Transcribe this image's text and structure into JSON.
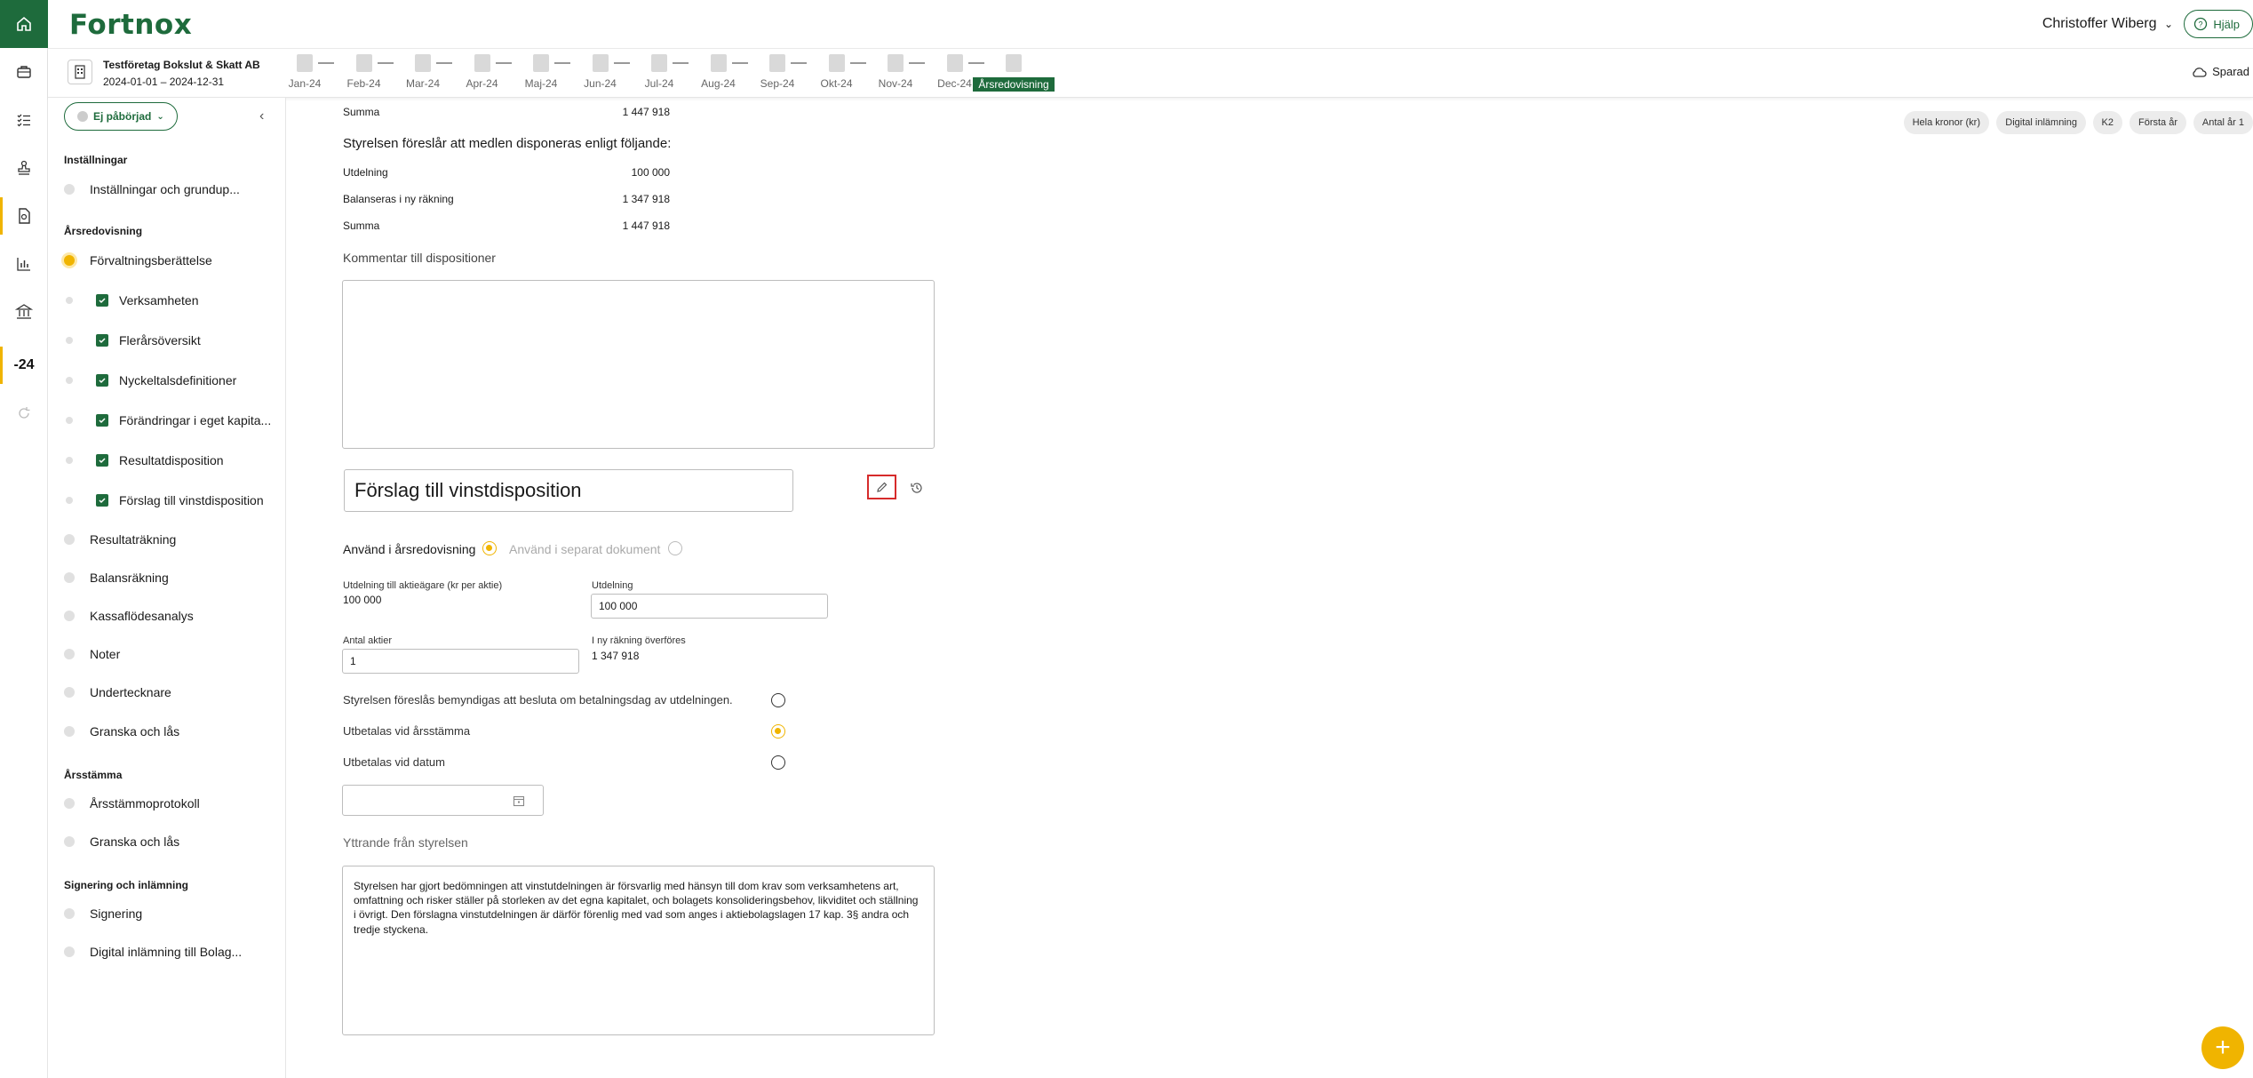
{
  "app": {
    "logo": "Fortnox",
    "user": "Christoffer Wiberg",
    "help": "Hjälp",
    "saved": "Sparad"
  },
  "rail": {
    "year_label": "-24"
  },
  "company": {
    "name": "Testföretag Bokslut & Skatt AB",
    "period": "2024-01-01 – 2024-12-31"
  },
  "timeline": [
    "Jan-24",
    "Feb-24",
    "Mar-24",
    "Apr-24",
    "Maj-24",
    "Jun-24",
    "Jul-24",
    "Aug-24",
    "Sep-24",
    "Okt-24",
    "Nov-24",
    "Dec-24",
    "Årsredovisning"
  ],
  "sidebar": {
    "status": "Ej påbörjad",
    "sections": {
      "settings": "Inställningar",
      "annual_report": "Årsredovisning",
      "agm": "Årsstämma",
      "signing": "Signering och inlämning"
    },
    "items": {
      "settings_basics": "Inställningar och grundup...",
      "management_report": "Förvaltningsberättelse",
      "operations": "Verksamheten",
      "multi_year": "Flerårsöversikt",
      "key_ratios": "Nyckeltalsdefinitioner",
      "equity_changes": "Förändringar i eget kapita...",
      "result_disposition": "Resultatdisposition",
      "profit_proposal": "Förslag till vinstdisposition",
      "income_statement": "Resultaträkning",
      "balance_sheet": "Balansräkning",
      "cash_flow": "Kassaflödesanalys",
      "notes": "Noter",
      "signatories": "Undertecknare",
      "review_lock_1": "Granska och lås",
      "agm_minutes": "Årsstämmoprotokoll",
      "review_lock_2": "Granska och lås",
      "signing": "Signering",
      "digital_submission": "Digital inlämning till Bolag..."
    }
  },
  "chips": [
    "Hela kronor (kr)",
    "Digital inlämning",
    "K2",
    "Första år",
    "Antal år 1"
  ],
  "main": {
    "sum_top_label": "Summa",
    "sum_top_value": "1 447 918",
    "proposal_heading": "Styrelsen föreslår att medlen disponeras enligt följande:",
    "dividend_label": "Utdelning",
    "dividend_value": "100 000",
    "carried_label": "Balanseras i ny räkning",
    "carried_value": "1 347 918",
    "sum_label": "Summa",
    "sum_value": "1 447 918",
    "comment_label": "Kommentar till dispositioner",
    "comment_text": "",
    "title_value": "Förslag till vinstdisposition",
    "use_in_report": "Använd i årsredovisning",
    "use_separate": "Använd i separat dokument",
    "dividend_per_share_label": "Utdelning till aktieägare (kr per aktie)",
    "dividend_per_share_value": "100 000",
    "dividend_field_label": "Utdelning",
    "dividend_field_value": "100 000",
    "shares_label": "Antal aktier",
    "shares_value": "1",
    "carried_over_label": "I ny räkning överföres",
    "carried_over_value": "1 347 918",
    "authorize_label": "Styrelsen föreslås bemyndigas att besluta om betalningsdag av utdelningen.",
    "pay_at_agm": "Utbetalas vid årsstämma",
    "pay_at_date": "Utbetalas vid datum",
    "date_value": "",
    "statement_label": "Yttrande från styrelsen",
    "statement_text": "Styrelsen har gjort bedömningen att vinstutdelningen är försvarlig med hänsyn till dom krav som verksamhetens art, omfattning och risker ställer på storleken av det egna kapitalet, och bolagets konsolideringsbehov, likviditet och ställning i övrigt. Den förslagna vinstutdelningen är därför förenlig med vad som anges i aktiebolagslagen 17 kap. 3§ andra och tredje styckena."
  },
  "colors": {
    "brand": "#1e6b3c",
    "accent": "#f0b400"
  }
}
